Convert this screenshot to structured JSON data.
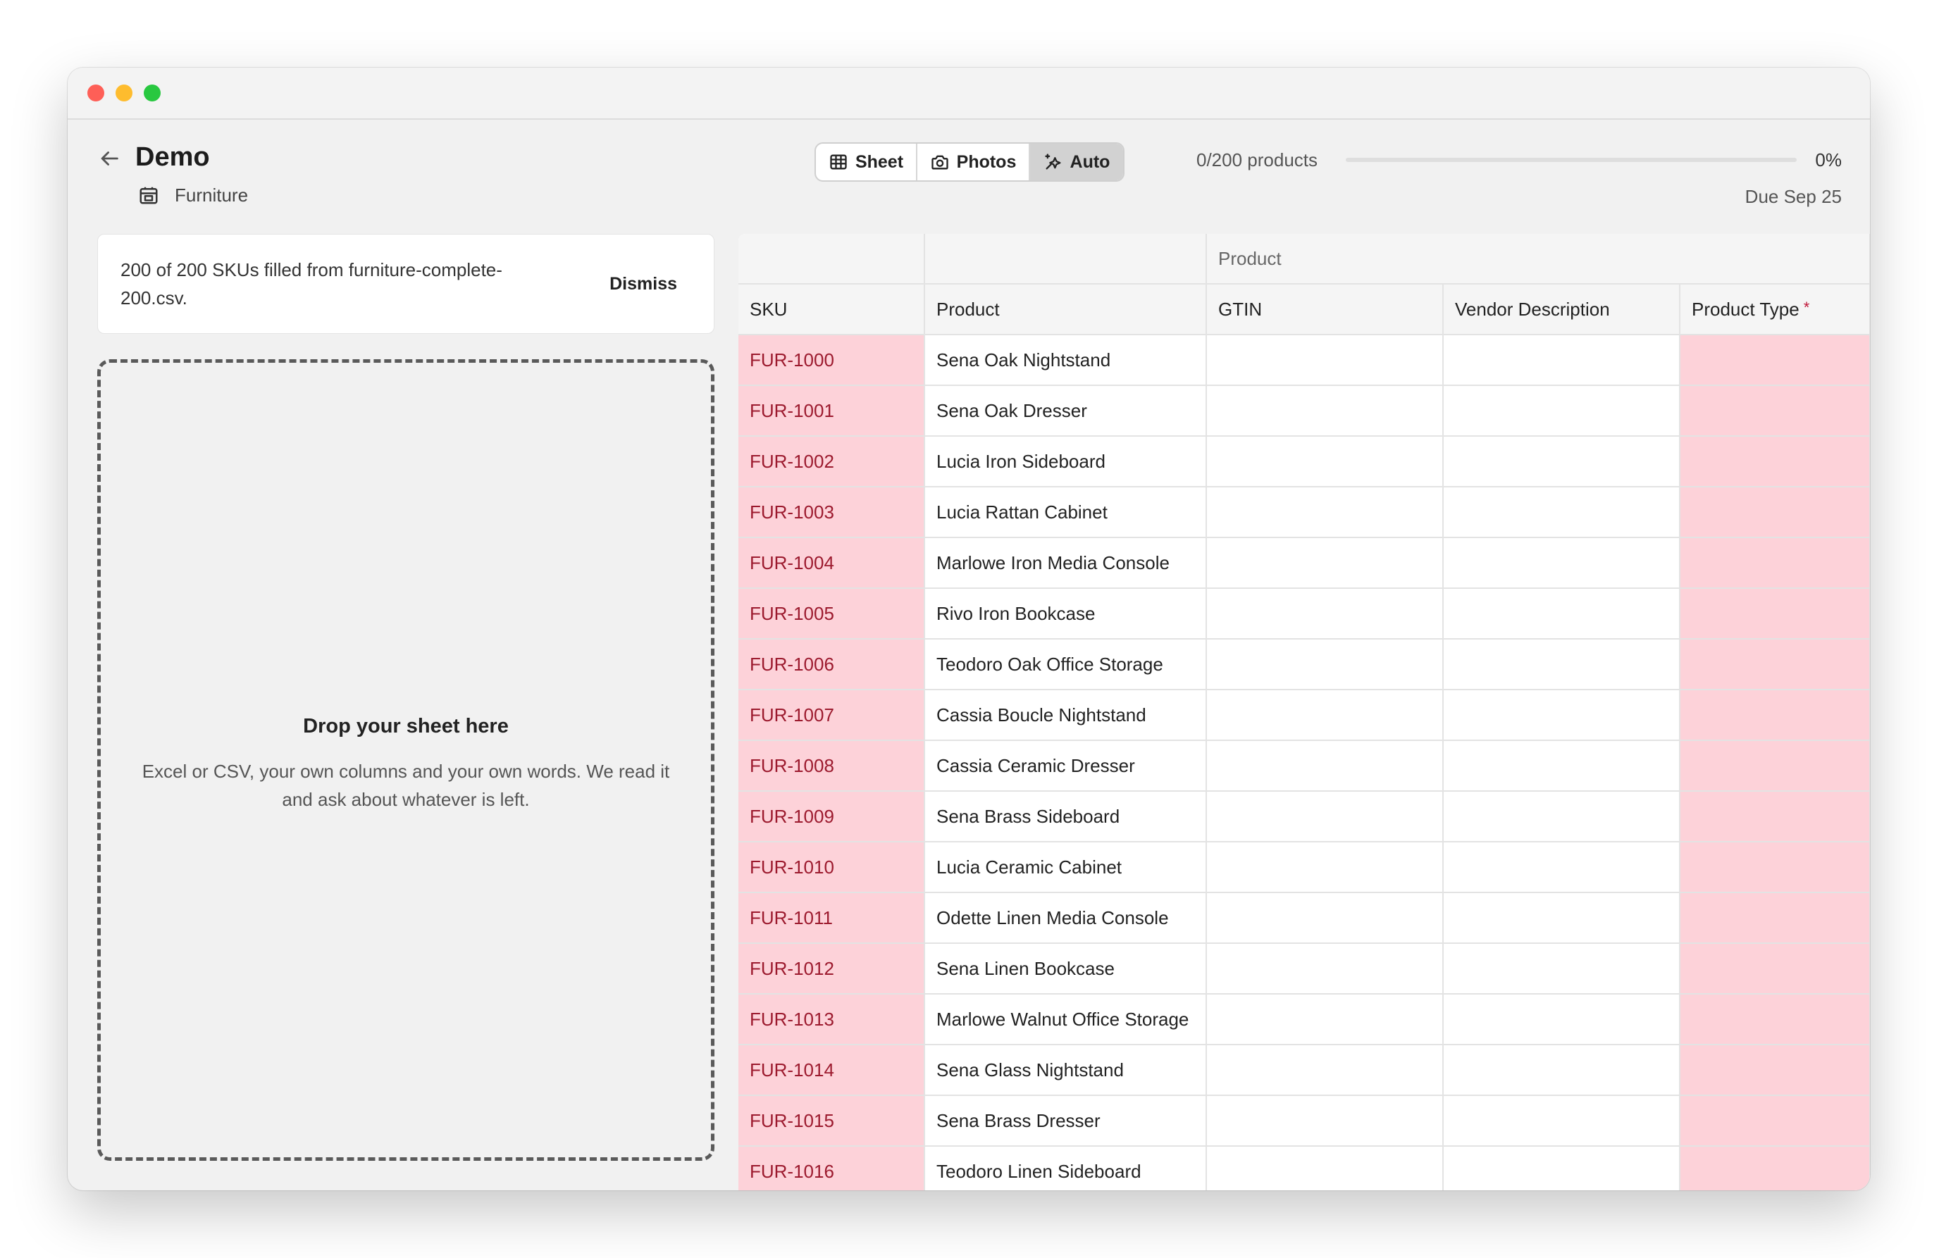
{
  "header": {
    "title": "Demo",
    "category": "Furniture",
    "back_icon": "arrow-left-icon",
    "category_icon": "store-icon"
  },
  "view_switcher": {
    "options": [
      {
        "label": "Sheet",
        "icon": "table-icon"
      },
      {
        "label": "Photos",
        "icon": "camera-icon"
      },
      {
        "label": "Auto",
        "icon": "sparkle-icon"
      }
    ],
    "selected": "Auto"
  },
  "progress": {
    "count_text": "0/200 products",
    "fraction": 0,
    "percent_text": "0%",
    "due_text": "Due Sep 25"
  },
  "notice": {
    "text": "200 of 200 SKUs filled from furniture-complete-200.csv.",
    "dismiss_label": "Dismiss"
  },
  "dropzone": {
    "title": "Drop your sheet here",
    "subtitle": "Excel or CSV, your own columns and your own words. We read it and ask about whatever is left."
  },
  "table": {
    "group_label": "Product",
    "columns": [
      "SKU",
      "Product",
      "GTIN",
      "Vendor Description",
      "Product Type"
    ],
    "required_marker": "*",
    "rows": [
      {
        "sku": "FUR-1000",
        "product": "Sena Oak Nightstand"
      },
      {
        "sku": "FUR-1001",
        "product": "Sena Oak Dresser"
      },
      {
        "sku": "FUR-1002",
        "product": "Lucia Iron Sideboard"
      },
      {
        "sku": "FUR-1003",
        "product": "Lucia Rattan Cabinet"
      },
      {
        "sku": "FUR-1004",
        "product": "Marlowe Iron Media Console"
      },
      {
        "sku": "FUR-1005",
        "product": "Rivo Iron Bookcase"
      },
      {
        "sku": "FUR-1006",
        "product": "Teodoro Oak Office Storage"
      },
      {
        "sku": "FUR-1007",
        "product": "Cassia Boucle Nightstand"
      },
      {
        "sku": "FUR-1008",
        "product": "Cassia Ceramic Dresser"
      },
      {
        "sku": "FUR-1009",
        "product": "Sena Brass Sideboard"
      },
      {
        "sku": "FUR-1010",
        "product": "Lucia Ceramic Cabinet"
      },
      {
        "sku": "FUR-1011",
        "product": "Odette Linen Media Console"
      },
      {
        "sku": "FUR-1012",
        "product": "Sena Linen Bookcase"
      },
      {
        "sku": "FUR-1013",
        "product": "Marlowe Walnut Office Storage"
      },
      {
        "sku": "FUR-1014",
        "product": "Sena Glass Nightstand"
      },
      {
        "sku": "FUR-1015",
        "product": "Sena Brass Dresser"
      },
      {
        "sku": "FUR-1016",
        "product": "Teodoro Linen Sideboard"
      }
    ]
  },
  "colors": {
    "missing_cell_bg": "#fdd2d9",
    "missing_text": "#9c1a2e",
    "required_star": "#c0183a",
    "traffic_red": "#fe5f57",
    "traffic_yellow": "#febc2e",
    "traffic_green": "#28c840"
  }
}
